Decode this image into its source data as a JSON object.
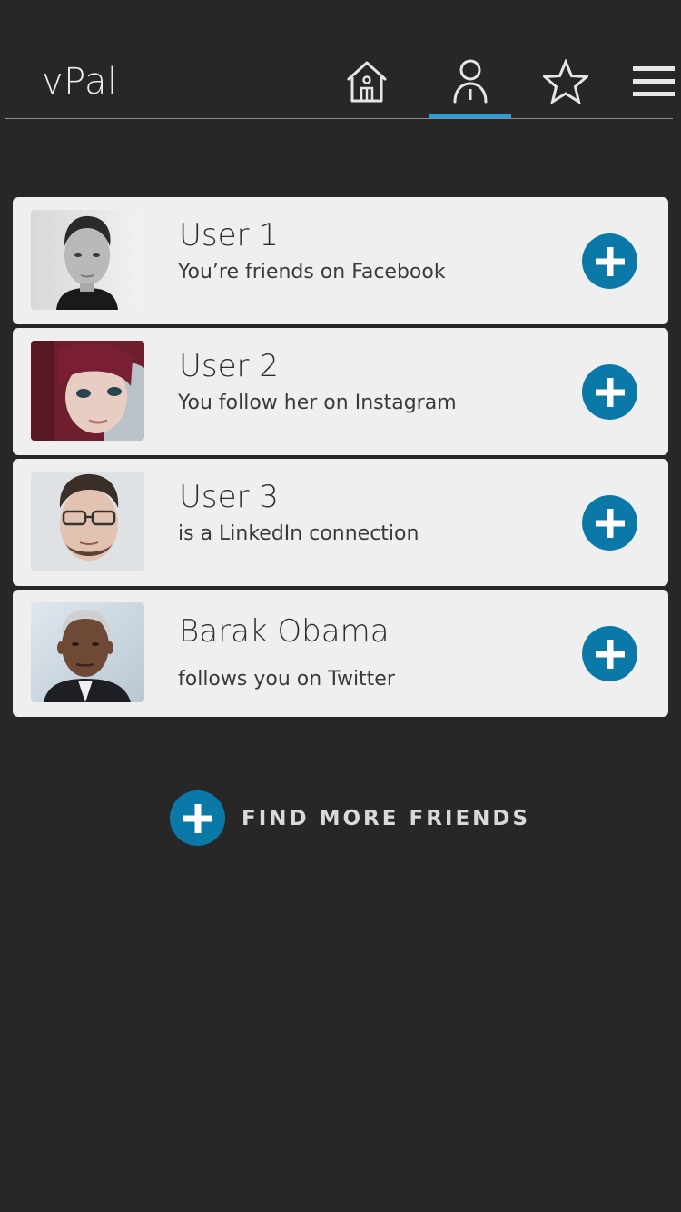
{
  "header": {
    "title": "vPal",
    "nav": [
      {
        "name": "home",
        "icon": "home-icon"
      },
      {
        "name": "friends",
        "icon": "person-icon",
        "active": true
      },
      {
        "name": "favorites",
        "icon": "star-icon"
      },
      {
        "name": "menu",
        "icon": "hamburger-menu-icon"
      }
    ]
  },
  "friends": [
    {
      "name": "User 1",
      "subtitle": "You’re friends on Facebook",
      "avatar": "avatar-photo-user-1"
    },
    {
      "name": "User 2",
      "subtitle": "You follow her on Instagram",
      "avatar": "avatar-photo-user-2"
    },
    {
      "name": "User 3",
      "subtitle": "is a LinkedIn connection",
      "avatar": "avatar-photo-user-3"
    },
    {
      "name": "Barak Obama",
      "subtitle": "follows you on Twitter",
      "avatar": "avatar-photo-barak-obama"
    }
  ],
  "find_more": {
    "label": "FIND MORE FRIENDS"
  },
  "colors": {
    "background": "#272727",
    "card": "#efefef",
    "accent": "#0b79a8",
    "tab_indicator": "#2b9ed6"
  }
}
